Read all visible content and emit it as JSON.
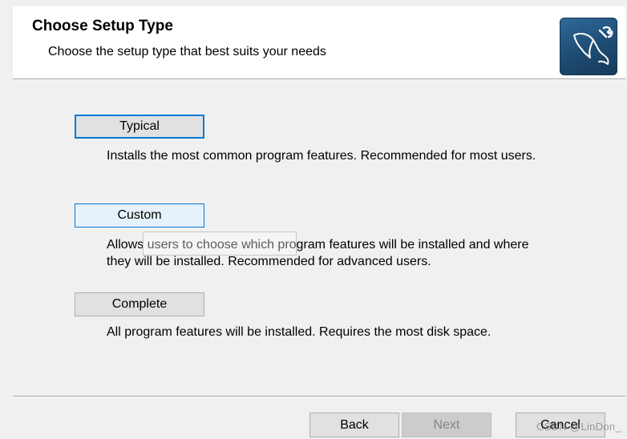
{
  "header": {
    "title": "Choose Setup Type",
    "subtitle": "Choose the setup type that best suits your needs",
    "logo_icon": "mysql-dolphin-icon"
  },
  "options": {
    "typical": {
      "label": "Typical",
      "description": "Installs the most common program features. Recommended for most users."
    },
    "custom": {
      "label": "Custom",
      "description_line1": "Allows users to choose which program features will be installed and where",
      "description_line2": "they will be installed. Recommended for advanced users."
    },
    "complete": {
      "label": "Complete",
      "description": "All program features will be installed. Requires the most disk space."
    }
  },
  "footer": {
    "back_label": "Back",
    "next_label": "Next",
    "cancel_label": "Cancel",
    "next_enabled": false
  },
  "watermark": "CSDN @LinDon_",
  "colors": {
    "accent": "#0078d7",
    "background": "#f0f0f0",
    "header_background": "#ffffff",
    "logo_background": "#1e4b73"
  }
}
